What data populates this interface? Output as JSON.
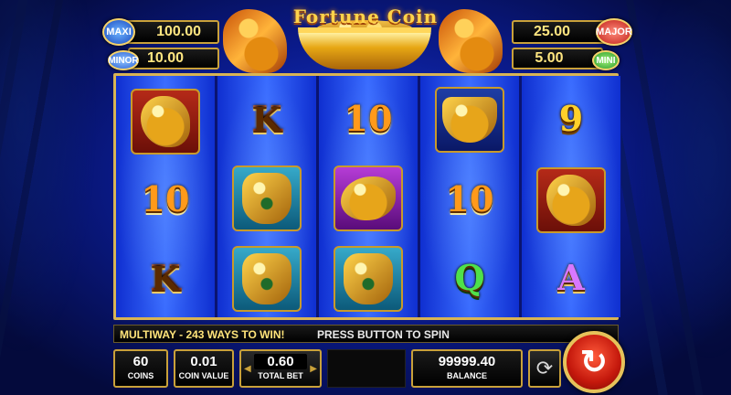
{
  "game": {
    "title": "Fortune Coin"
  },
  "jackpots": {
    "maxi": {
      "label": "MAXI",
      "value": "100.00"
    },
    "minor": {
      "label": "MINOR",
      "value": "10.00"
    },
    "major": {
      "label": "MAJOR",
      "value": "25.00"
    },
    "mini": {
      "label": "MINI",
      "value": "5.00"
    }
  },
  "reels": [
    [
      "foo-dog-lion",
      "10",
      "K"
    ],
    [
      "K",
      "golden-dragon-vase",
      "golden-dragon-vase"
    ],
    [
      "10",
      "golden-koi-fish",
      "golden-dragon-vase"
    ],
    [
      "gold-ingot-wild",
      "10",
      "Q"
    ],
    [
      "9",
      "foo-dog-lion",
      "A"
    ]
  ],
  "symbol_text": {
    "r0_1": "10",
    "r0_2": "K",
    "r1_0": "K",
    "r2_0": "10",
    "r3_1": "10",
    "r3_2": "Q",
    "r4_0": "9",
    "r4_2": "A"
  },
  "info_bar": {
    "ways": "MULTIWAY - 243 WAYS TO WIN!",
    "prompt": "PRESS BUTTON TO SPIN"
  },
  "controls": {
    "coins": {
      "value": "60",
      "label": "COINS"
    },
    "coin_value": {
      "value": "0.01",
      "label": "COIN VALUE"
    },
    "total_bet": {
      "value": "0.60",
      "label": "TOTAL BET"
    },
    "balance": {
      "value": "99999.40",
      "label": "BALANCE"
    },
    "autoplay_icon": "refresh-arrows-icon",
    "spin_icon": "spin-arrow-icon"
  },
  "colors": {
    "accent_gold": "#c9a13a",
    "reel_blue": "#1a3bd6",
    "spin_red": "#c4180c"
  }
}
